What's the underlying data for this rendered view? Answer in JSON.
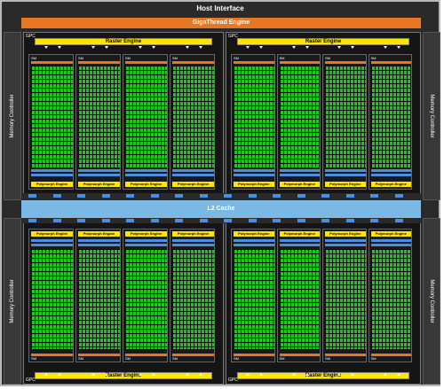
{
  "host_interface": "Host Interface",
  "gigathread_engine": "GigaThread Engine",
  "memory_controller": "Memory Controller",
  "l2_cache": "L2 Cache",
  "gpc_label": "GPC",
  "raster_engine": "Raster Engine",
  "polymorph_engine": "Polymorph Engine",
  "sm_label": "SM",
  "gpcs": [
    {
      "position": "top-left"
    },
    {
      "position": "top-right"
    },
    {
      "position": "bottom-left"
    },
    {
      "position": "bottom-right"
    }
  ],
  "colors": {
    "background": "#2a2a2a",
    "gigathread": "#e87722",
    "raster": "#ffe600",
    "cores": "#22c322",
    "l2": "#79b9e5",
    "blue": "#4b8fe0"
  }
}
